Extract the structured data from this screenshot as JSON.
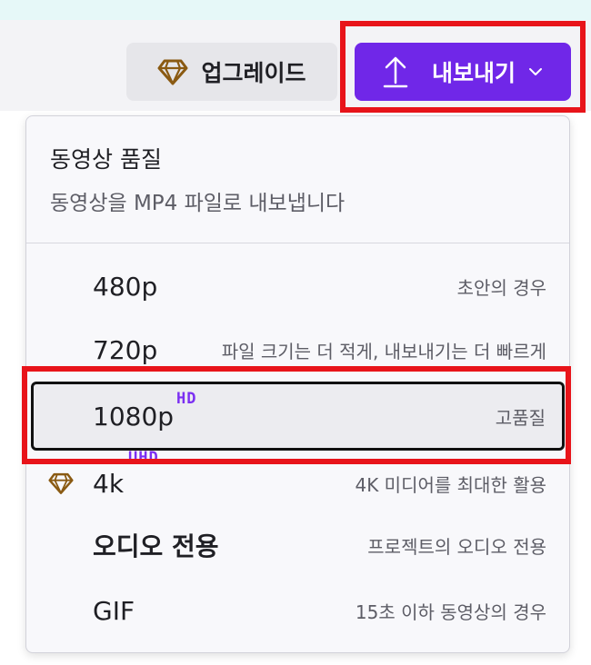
{
  "toolbar": {
    "upgrade_label": "업그레이드",
    "export_label": "내보내기"
  },
  "menu": {
    "title": "동영상 품질",
    "subtitle": "동영상을 MP4 파일로 내보냅니다",
    "options": [
      {
        "label": "480p",
        "desc": "초안의 경우"
      },
      {
        "label": "720p",
        "desc": "파일 크기는 더 적게, 내보내기는 더 빠르게"
      },
      {
        "label": "1080p",
        "badge": "HD",
        "desc": "고품질",
        "selected": true
      },
      {
        "label": "4k",
        "badge": "UHD",
        "desc": "4K 미디어를 최대한 활용",
        "premium": true
      },
      {
        "label": "오디오 전용",
        "desc": "프로젝트의 오디오 전용"
      },
      {
        "label": "GIF",
        "desc": "15초 이하 동영상의 경우"
      }
    ]
  },
  "colors": {
    "accent": "#7027e8",
    "highlight": "#e8141a",
    "gem": "#8a5a12",
    "badge": "#7b2ff2"
  }
}
